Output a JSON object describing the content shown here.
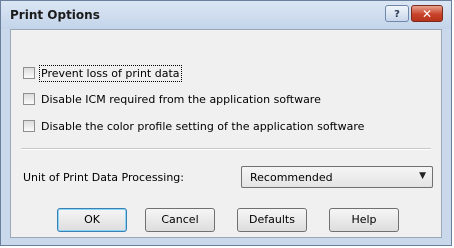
{
  "window": {
    "title": "Print Options",
    "help_glyph": "?",
    "close_glyph": "✕"
  },
  "options": [
    {
      "label": "Prevent loss of print data",
      "checked": false
    },
    {
      "label": "Disable ICM required from the application software",
      "checked": false
    },
    {
      "label": "Disable the color profile setting of the application software",
      "checked": false
    }
  ],
  "unit": {
    "label": "Unit of Print Data Processing:",
    "value": "Recommended"
  },
  "buttons": {
    "ok": "OK",
    "cancel": "Cancel",
    "defaults": "Defaults",
    "help": "Help"
  }
}
